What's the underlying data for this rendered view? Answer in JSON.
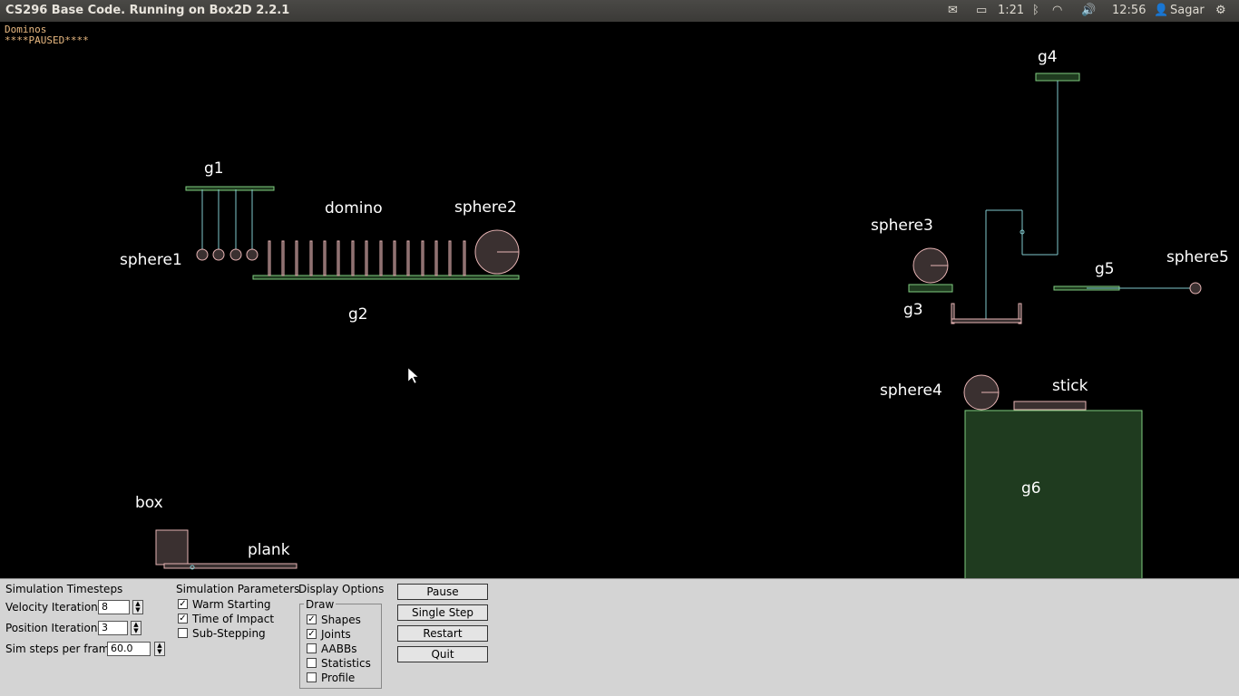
{
  "window": {
    "title": "CS296 Base Code. Running on Box2D 2.2.1"
  },
  "tray": {
    "battery": "1:21",
    "clock": "12:56",
    "user": "Sagar"
  },
  "overlay": {
    "name": "Dominos",
    "status": "****PAUSED****"
  },
  "labels": {
    "g1": "g1",
    "g2": "g2",
    "g3": "g3",
    "g4": "g4",
    "g5": "g5",
    "g6": "g6",
    "domino": "domino",
    "sphere1": "sphere1",
    "sphere2": "sphere2",
    "sphere3": "sphere3",
    "sphere4": "sphere4",
    "sphere5": "sphere5",
    "stick": "stick",
    "box": "box",
    "plank": "plank"
  },
  "controls": {
    "timesteps_heading": "Simulation Timesteps",
    "velocity_label": "Velocity Iterations",
    "velocity_value": "8",
    "position_label": "Position Iterations",
    "position_value": "3",
    "hz_label": "Sim steps per frame",
    "hz_value": "60.0",
    "params_heading": "Simulation Parameters",
    "warm_starting": "Warm Starting",
    "time_of_impact": "Time of Impact",
    "sub_stepping": "Sub-Stepping",
    "display_heading": "Display Options",
    "draw_group": "Draw",
    "shapes": "Shapes",
    "joints": "Joints",
    "aabbs": "AABBs",
    "statistics": "Statistics",
    "profile": "Profile",
    "pause": "Pause",
    "single_step": "Single Step",
    "restart": "Restart",
    "quit": "Quit"
  },
  "colors": {
    "static_fill": "#1f3b1f",
    "static_stroke": "#7fcc7f",
    "dynamic_fill": "#3a3030",
    "dynamic_stroke": "#e6b3b3",
    "joint": "#80c8cc"
  }
}
